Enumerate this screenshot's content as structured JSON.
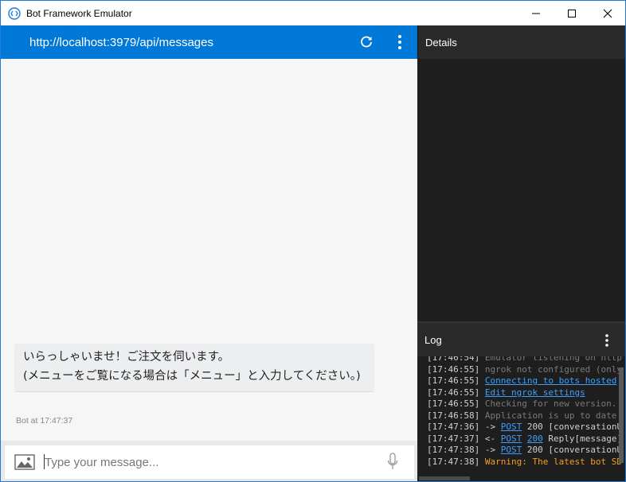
{
  "window": {
    "title": "Bot Framework Emulator"
  },
  "chat": {
    "endpoint_url": "http://localhost:3979/api/messages",
    "message": {
      "line1": "いらっしゃいませ！ご注文を伺います。",
      "line2": "(メニューをご覧になる場合は「メニュー」と入力してください。)",
      "meta": "Bot at 17:47:37"
    },
    "input": {
      "placeholder": "Type your message...",
      "value": ""
    }
  },
  "details": {
    "title": "Details"
  },
  "log": {
    "title": "Log",
    "entries": [
      {
        "time": "[17:46:54]",
        "parts": [
          {
            "text": " Emulator listening on http",
            "style": "dim"
          }
        ]
      },
      {
        "time": "[17:46:55]",
        "parts": [
          {
            "text": " ngrok not configured (only",
            "style": "dim"
          }
        ]
      },
      {
        "time": "[17:46:55]",
        "parts": [
          {
            "text": " ",
            "style": "plain"
          },
          {
            "text": "Connecting to bots hosted",
            "style": "link"
          }
        ]
      },
      {
        "time": "[17:46:55]",
        "parts": [
          {
            "text": " ",
            "style": "plain"
          },
          {
            "text": "Edit ngrok settings",
            "style": "link"
          }
        ]
      },
      {
        "time": "[17:46:55]",
        "parts": [
          {
            "text": " Checking for new version...",
            "style": "dim"
          }
        ]
      },
      {
        "time": "[17:46:58]",
        "parts": [
          {
            "text": " Application is up to date.",
            "style": "dim"
          }
        ]
      },
      {
        "time": "[17:47:36]",
        "parts": [
          {
            "text": " -> ",
            "style": "plain"
          },
          {
            "text": "POST",
            "style": "link"
          },
          {
            "text": " 200 [conversationU",
            "style": "plain"
          }
        ]
      },
      {
        "time": "[17:47:37]",
        "parts": [
          {
            "text": " <- ",
            "style": "plain"
          },
          {
            "text": "POST",
            "style": "link"
          },
          {
            "text": " ",
            "style": "plain"
          },
          {
            "text": "200",
            "style": "link"
          },
          {
            "text": " Reply[message]",
            "style": "plain"
          }
        ]
      },
      {
        "time": "[17:47:38]",
        "parts": [
          {
            "text": " -> ",
            "style": "plain"
          },
          {
            "text": "POST",
            "style": "link"
          },
          {
            "text": " 200 [conversationU",
            "style": "plain"
          }
        ]
      },
      {
        "time": "[17:47:38]",
        "parts": [
          {
            "text": " Warning: The latest bot SD",
            "style": "warn"
          }
        ]
      }
    ]
  },
  "colors": {
    "accent": "#0078d7",
    "link": "#3aa0ff",
    "warning": "#f0a020",
    "dark_bg": "#1e1e1e"
  },
  "icons": {
    "app": "bot-emulator-icon",
    "refresh": "refresh-icon",
    "more": "more-vertical-icon",
    "image": "image-upload-icon",
    "mic": "microphone-icon",
    "minimize": "minimize-icon",
    "maximize": "maximize-icon",
    "close": "close-icon"
  }
}
